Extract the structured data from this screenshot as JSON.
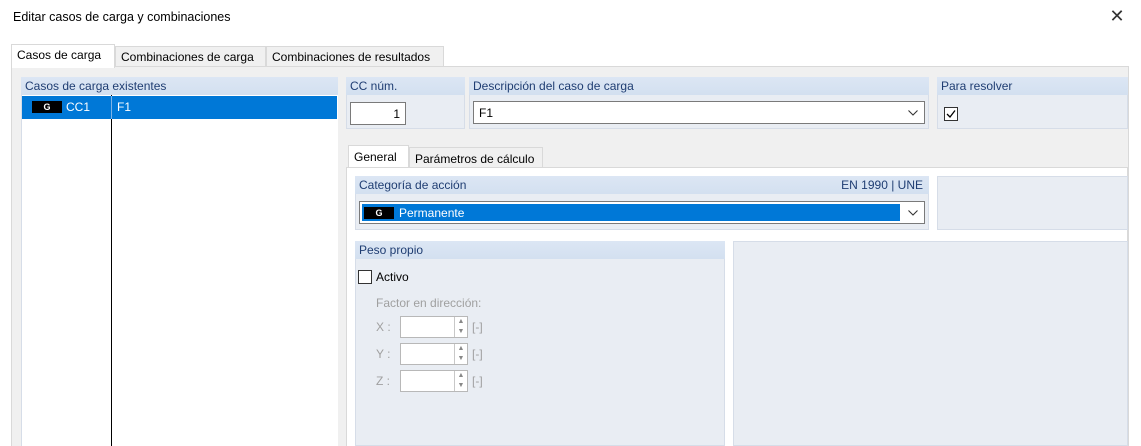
{
  "window": {
    "title": "Editar casos de carga y combinaciones",
    "close_glyph": "✕"
  },
  "tabs": [
    {
      "label": "Casos de carga",
      "active": true
    },
    {
      "label": "Combinaciones de carga",
      "active": false
    },
    {
      "label": "Combinaciones de resultados",
      "active": false
    }
  ],
  "existing_cases": {
    "header": "Casos de carga existentes",
    "rows": [
      {
        "badge": "G",
        "id": "CC1",
        "description": "F1",
        "selected": true
      }
    ]
  },
  "cc_number": {
    "header": "CC núm.",
    "value": "1"
  },
  "description": {
    "header": "Descripción del caso de carga",
    "value": "F1"
  },
  "to_solve": {
    "header": "Para resolver",
    "checked": true
  },
  "subtabs": [
    {
      "label": "General",
      "active": true
    },
    {
      "label": "Parámetros de cálculo",
      "active": false
    }
  ],
  "action_category": {
    "header": "Categoría de acción",
    "standard": "EN 1990 | UNE",
    "badge": "G",
    "value": "Permanente"
  },
  "self_weight": {
    "header": "Peso propio",
    "active_label": "Activo",
    "active_checked": false,
    "factor_label": "Factor en dirección:",
    "axes": [
      {
        "label": "X :",
        "value": "",
        "unit": "[-]"
      },
      {
        "label": "Y :",
        "value": "",
        "unit": "[-]"
      },
      {
        "label": "Z :",
        "value": "",
        "unit": "[-]"
      }
    ]
  },
  "colors": {
    "selection": "#0078d7",
    "group_header_bg": "#d3e0f0",
    "group_header_text": "#1f3d72",
    "group_box_bg": "#e9edf3"
  },
  "icons": {
    "close": "close-icon",
    "dropdown": "chevron-down-icon",
    "check": "check-icon",
    "spin_up": "spin-up-icon",
    "spin_down": "spin-down-icon"
  }
}
